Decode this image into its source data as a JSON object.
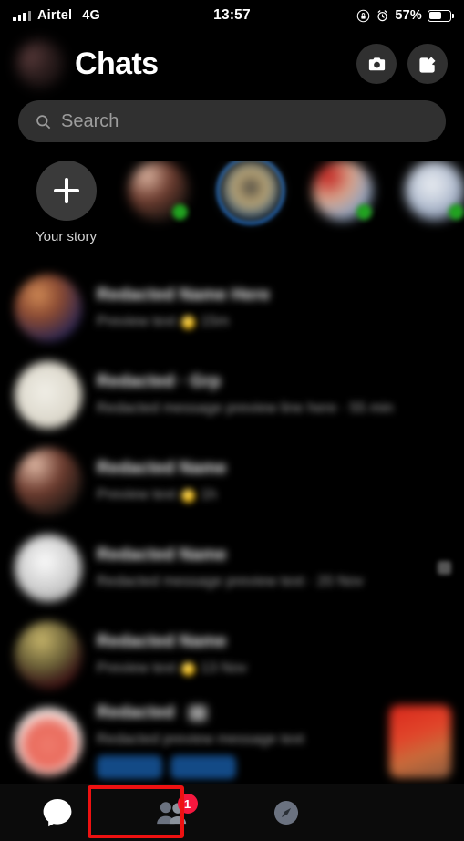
{
  "status_bar": {
    "carrier": "Airtel",
    "network": "4G",
    "time": "13:57",
    "battery_percent": "57%",
    "icons": [
      "signal-bars-icon",
      "rotation-lock-icon",
      "alarm-clock-icon",
      "battery-icon"
    ]
  },
  "header": {
    "title": "Chats",
    "avatar": "profile-avatar",
    "camera_label": "camera-icon",
    "compose_label": "compose-icon"
  },
  "search": {
    "placeholder": "Search",
    "value": "",
    "icon": "search-icon"
  },
  "stories": {
    "items": [
      {
        "label": "Your story",
        "type": "add",
        "online": false,
        "unseen": false
      },
      {
        "label": "",
        "type": "photo",
        "online": true,
        "unseen": false
      },
      {
        "label": "",
        "type": "photo",
        "online": false,
        "unseen": true
      },
      {
        "label": "",
        "type": "photo",
        "online": true,
        "unseen": false
      },
      {
        "label": "",
        "type": "photo",
        "online": true,
        "unseen": false
      }
    ]
  },
  "chats": {
    "rows": [
      {
        "name": "",
        "preview": "",
        "time": "",
        "has_emoji": true,
        "right": "none",
        "chips": false
      },
      {
        "name": "",
        "preview": "",
        "time": "",
        "has_emoji": false,
        "right": "none",
        "chips": false
      },
      {
        "name": "",
        "preview": "",
        "time": "",
        "has_emoji": true,
        "right": "none",
        "chips": false
      },
      {
        "name": "",
        "preview": "",
        "time": "",
        "has_emoji": false,
        "right": "icon",
        "chips": false
      },
      {
        "name": "",
        "preview": "",
        "time": "",
        "has_emoji": true,
        "right": "none",
        "chips": false
      },
      {
        "name": "",
        "preview": "",
        "time": "",
        "has_emoji": false,
        "right": "thumb",
        "chips": true
      }
    ]
  },
  "tabbar": {
    "tabs": [
      {
        "name": "chats-tab",
        "icon": "chat-bubble-icon",
        "active": true,
        "badge": ""
      },
      {
        "name": "people-tab",
        "icon": "people-icon",
        "active": false,
        "badge": "1"
      },
      {
        "name": "discover-tab",
        "icon": "compass-icon",
        "active": false,
        "badge": ""
      }
    ]
  },
  "annotation": {
    "color": "#ee1111",
    "target": "chats-tab"
  }
}
